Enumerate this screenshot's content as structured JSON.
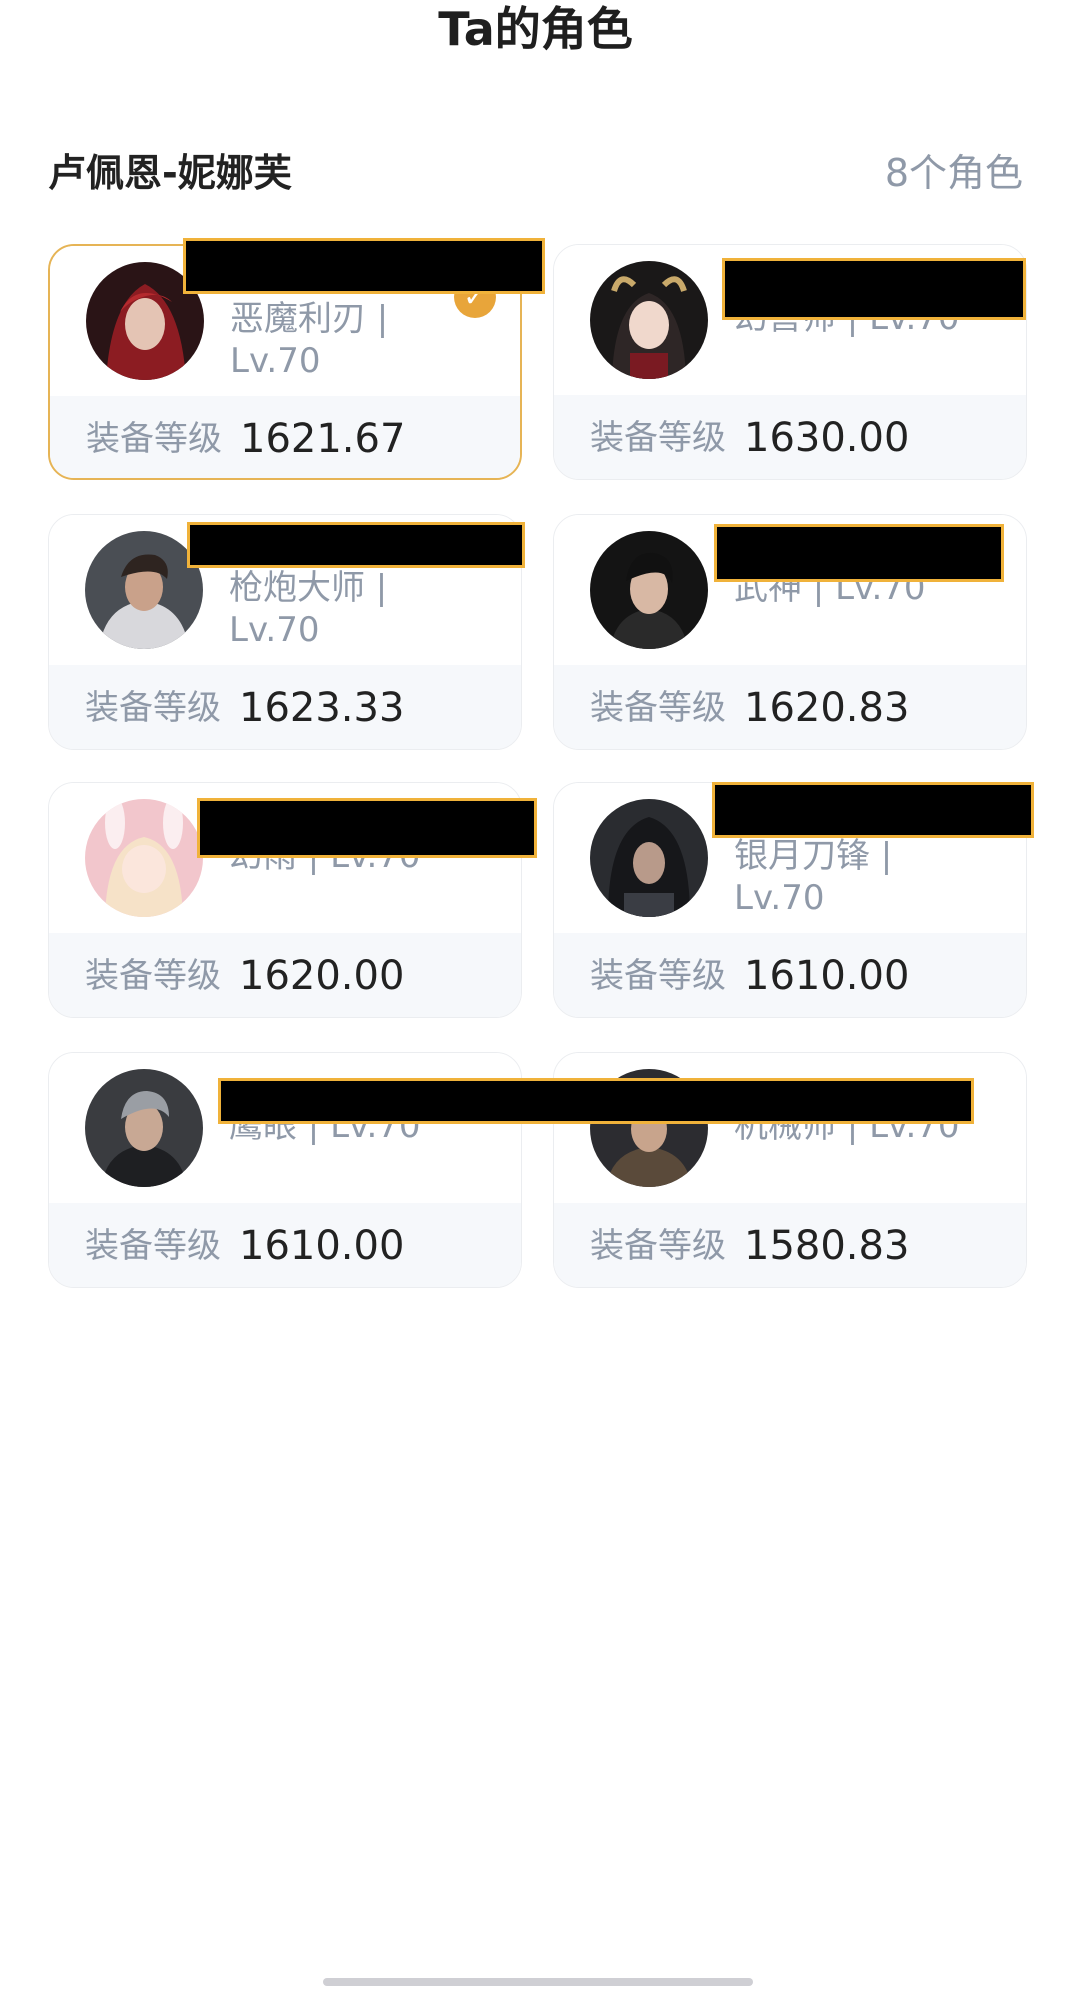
{
  "header": {
    "title": "Ta的角色"
  },
  "server": {
    "name": "卢佩恩-妮娜芙",
    "count": "8个角色"
  },
  "gear_label": "装备等级",
  "cards": [
    {
      "role": "恶魔利刃 | Lv.70",
      "gear": "1621.67",
      "selected": true,
      "avatar": "red-hair-female-avatar"
    },
    {
      "role": "幻兽师 | Lv.70",
      "gear": "1630.00",
      "selected": false,
      "avatar": "horned-girl-avatar"
    },
    {
      "role": "枪炮大师 | Lv.70",
      "gear": "1623.33",
      "selected": false,
      "avatar": "gunner-male-avatar"
    },
    {
      "role": "武神 | Lv.70",
      "gear": "1620.83",
      "selected": false,
      "avatar": "dark-hair-male-avatar"
    },
    {
      "role": "幻雨 | Lv.70",
      "gear": "1620.00",
      "selected": false,
      "avatar": "bunny-girl-avatar"
    },
    {
      "role": "银月刀锋 | Lv.70",
      "gear": "1610.00",
      "selected": false,
      "avatar": "hooded-avatar"
    },
    {
      "role": "鹰眼 | Lv.70",
      "gear": "1610.00",
      "selected": false,
      "avatar": "grey-hair-male-avatar"
    },
    {
      "role": "机械师 | Lv.70",
      "gear": "1580.83",
      "selected": false,
      "avatar": "machinist-avatar"
    }
  ],
  "colors": {
    "accent": "#e6b455",
    "muted_text": "#8f99a8",
    "card_bottom_bg": "#f6f8fb"
  }
}
